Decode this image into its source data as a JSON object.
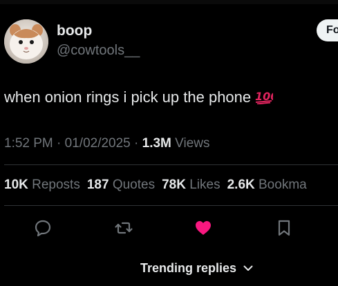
{
  "tweet": {
    "author": {
      "display_name": "boop",
      "handle": "@cowtools__",
      "avatar_icon": "hamster-avatar"
    },
    "follow_label": "Fo",
    "text": "when onion rings i pick up the phone",
    "emoji_icon": "hundred-points-icon",
    "meta": {
      "time": "1:52 PM",
      "sep1": " · ",
      "date": "01/02/2025",
      "sep2": " · ",
      "views_count": "1.3M",
      "views_label": " Views"
    },
    "stats": {
      "reposts_count": "10K",
      "reposts_label": " Reposts",
      "quotes_count": "187",
      "quotes_label": " Quotes",
      "likes_count": "78K",
      "likes_label": " Likes",
      "bookmarks_count": "2.6K",
      "bookmarks_label": " Bookma"
    },
    "actions": {
      "reply_icon": "reply-icon",
      "repost_icon": "repost-icon",
      "like_icon": "heart-icon",
      "bookmark_icon": "bookmark-icon",
      "liked": true,
      "like_color": "#f91880"
    },
    "trending_label": "Trending replies"
  },
  "colors": {
    "background": "#000000",
    "primary_text": "#e7e9ea",
    "secondary_text": "#71767b",
    "divider": "#2f3336",
    "like_accent": "#f91880"
  }
}
